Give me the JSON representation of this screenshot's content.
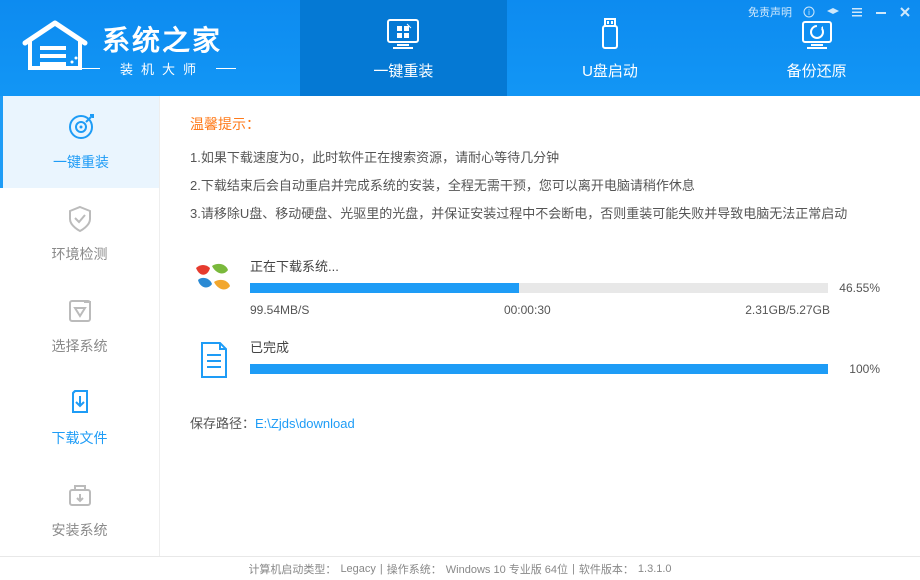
{
  "header": {
    "logo_title": "系统之家",
    "logo_subtitle": "装机大师",
    "tabs": [
      {
        "label": "一键重装",
        "icon": "reinstall"
      },
      {
        "label": "U盘启动",
        "icon": "usb"
      },
      {
        "label": "备份还原",
        "icon": "backup"
      }
    ],
    "disclaimer": "免责声明"
  },
  "sidebar": {
    "items": [
      {
        "label": "一键重装",
        "icon": "target"
      },
      {
        "label": "环境检测",
        "icon": "shield"
      },
      {
        "label": "选择系统",
        "icon": "select"
      },
      {
        "label": "下载文件",
        "icon": "download"
      },
      {
        "label": "安装系统",
        "icon": "install"
      }
    ]
  },
  "tips": {
    "title": "温馨提示：",
    "lines": [
      "1.如果下载速度为0，此时软件正在搜索资源，请耐心等待几分钟",
      "2.下载结束后会自动重启并完成系统的安装，全程无需干预，您可以离开电脑请稍作休息",
      "3.请移除U盘、移动硬盘、光驱里的光盘，并保证安装过程中不会断电，否则重装可能失败并导致电脑无法正常启动"
    ]
  },
  "download": {
    "system": {
      "label": "正在下载系统...",
      "percent": 46.55,
      "percent_text": "46.55%",
      "speed": "99.54MB/S",
      "elapsed": "00:00:30",
      "size": "2.31GB/5.27GB"
    },
    "complete": {
      "label": "已完成",
      "percent": 100,
      "percent_text": "100%"
    }
  },
  "save_path": {
    "label": "保存路径：",
    "value": "E:\\Zjds\\download"
  },
  "footer": {
    "boot_type_label": "计算机启动类型：",
    "boot_type": "Legacy",
    "os_label": "操作系统：",
    "os": "Windows 10 专业版 64位",
    "version_label": "软件版本：",
    "version": "1.3.1.0",
    "separator": " | "
  }
}
